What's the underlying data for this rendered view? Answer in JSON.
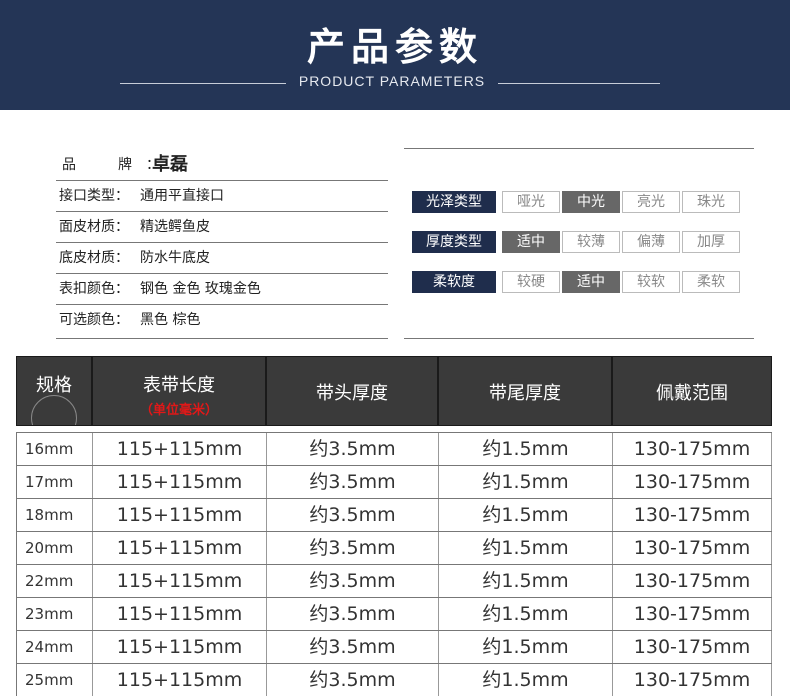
{
  "banner": {
    "title": "产品参数",
    "subtitle": "PRODUCT PARAMETERS"
  },
  "info": {
    "rows": [
      {
        "label": "品　牌：",
        "value": "卓磊"
      },
      {
        "label": "接口类型：",
        "value": "通用平直接口"
      },
      {
        "label": "面皮材质：",
        "value": "精选鳄鱼皮"
      },
      {
        "label": "底皮材质：",
        "value": "防水牛底皮"
      },
      {
        "label": "表扣颜色：",
        "value": "钢色 金色 玫瑰金色"
      },
      {
        "label": "可选颜色：",
        "value": "黑色  棕色"
      }
    ]
  },
  "options": [
    {
      "category": "光泽类型",
      "values": [
        "哑光",
        "中光",
        "亮光",
        "珠光"
      ],
      "selected": "中光"
    },
    {
      "category": "厚度类型",
      "values": [
        "适中",
        "较薄",
        "偏薄",
        "加厚"
      ],
      "selected": "适中"
    },
    {
      "category": "柔软度",
      "values": [
        "较硬",
        "适中",
        "较软",
        "柔软"
      ],
      "selected": "适中"
    }
  ],
  "table": {
    "headers": {
      "spec": "规格",
      "length": "表带长度",
      "length_unit": "（单位毫米）",
      "head_thickness": "带头厚度",
      "tail_thickness": "带尾厚度",
      "wear_range": "佩戴范围"
    },
    "rows": [
      [
        "16mm",
        "115+115mm",
        "约3.5mm",
        "约1.5mm",
        "130-175mm"
      ],
      [
        "17mm",
        "115+115mm",
        "约3.5mm",
        "约1.5mm",
        "130-175mm"
      ],
      [
        "18mm",
        "115+115mm",
        "约3.5mm",
        "约1.5mm",
        "130-175mm"
      ],
      [
        "20mm",
        "115+115mm",
        "约3.5mm",
        "约1.5mm",
        "130-175mm"
      ],
      [
        "22mm",
        "115+115mm",
        "约3.5mm",
        "约1.5mm",
        "130-175mm"
      ],
      [
        "23mm",
        "115+115mm",
        "约3.5mm",
        "约1.5mm",
        "130-175mm"
      ],
      [
        "24mm",
        "115+115mm",
        "约3.5mm",
        "约1.5mm",
        "130-175mm"
      ],
      [
        "25mm",
        "115+115mm",
        "约3.5mm",
        "约1.5mm",
        "130-175mm"
      ]
    ]
  },
  "colors": {
    "banner_bg": "#243556",
    "category_bg": "#1f2d4c",
    "selected_bg": "#676767",
    "header_bg": "#3a3a3a",
    "unit_red": "#e01818"
  }
}
